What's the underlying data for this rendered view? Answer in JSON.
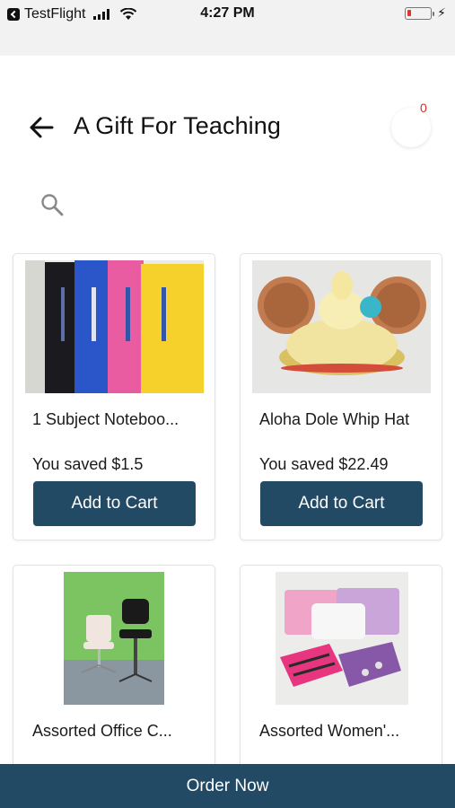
{
  "status_bar": {
    "app_name": "TestFlight",
    "time": "4:27 PM"
  },
  "header": {
    "title": "A Gift For Teaching",
    "cart_count": "0"
  },
  "products": [
    {
      "name": "1 Subject Noteboo...",
      "saved": "You saved $1.5",
      "button": "Add to Cart"
    },
    {
      "name": "Aloha Dole Whip Hat",
      "saved": "You saved $22.49",
      "button": "Add to Cart"
    },
    {
      "name": "Assorted Office C..."
    },
    {
      "name": "Assorted Women'..."
    }
  ],
  "footer": {
    "order_label": "Order Now"
  },
  "colors": {
    "primary": "#234a64",
    "badge": "#d32f2f"
  },
  "icons": [
    "back-app-icon",
    "signal-icon",
    "wifi-icon",
    "battery-icon",
    "back-arrow-icon",
    "cart-icon",
    "search-icon"
  ]
}
